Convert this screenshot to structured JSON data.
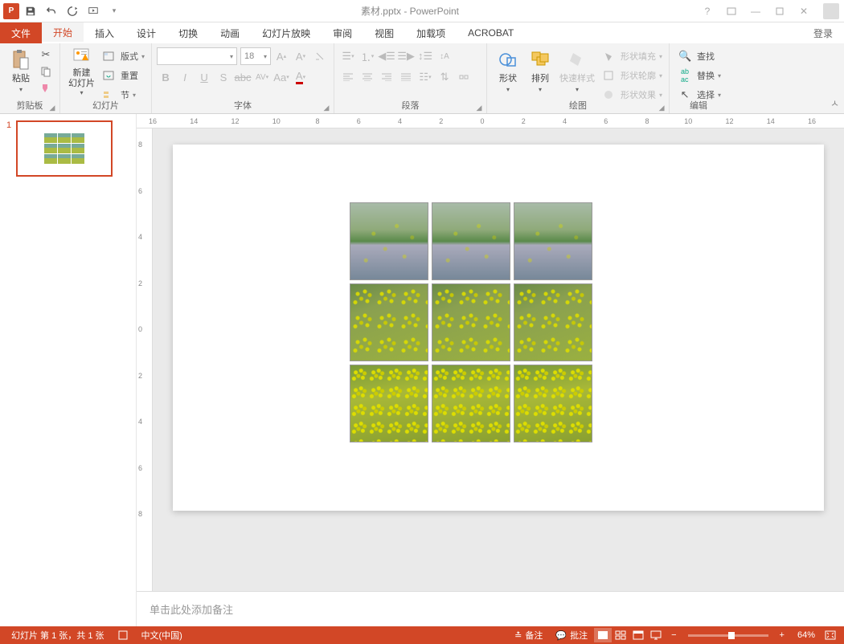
{
  "title": "素材.pptx - PowerPoint",
  "qat": {
    "save": "保存",
    "undo": "撤销",
    "redo": "恢复",
    "start": "从头开始"
  },
  "tabs": {
    "file": "文件",
    "home": "开始",
    "insert": "插入",
    "design": "设计",
    "transition": "切换",
    "animation": "动画",
    "slideshow": "幻灯片放映",
    "review": "审阅",
    "view": "视图",
    "addins": "加载项",
    "acrobat": "ACROBAT",
    "login": "登录"
  },
  "ribbon": {
    "clipboard": {
      "paste": "粘贴",
      "label": "剪贴板"
    },
    "slides": {
      "new": "新建\n幻灯片",
      "layout": "版式",
      "reset": "重置",
      "section": "节",
      "label": "幻灯片"
    },
    "font": {
      "name": "",
      "size": "18",
      "label": "字体"
    },
    "paragraph": {
      "label": "段落"
    },
    "drawing": {
      "shapes": "形状",
      "arrange": "排列",
      "quickstyles": "快速样式",
      "fill": "形状填充",
      "outline": "形状轮廓",
      "effects": "形状效果",
      "label": "绘图"
    },
    "editing": {
      "find": "查找",
      "replace": "替换",
      "select": "选择",
      "label": "编辑"
    }
  },
  "ruler_h": [
    "16",
    "14",
    "12",
    "10",
    "8",
    "6",
    "4",
    "2",
    "0",
    "2",
    "4",
    "6",
    "8",
    "10",
    "12",
    "14",
    "16"
  ],
  "ruler_v": [
    "8",
    "6",
    "4",
    "2",
    "0",
    "2",
    "4",
    "6",
    "8"
  ],
  "slide_number": "1",
  "notes_placeholder": "单击此处添加备注",
  "status": {
    "slide_info": "幻灯片 第 1 张，共 1 张",
    "language": "中文(中国)",
    "notes": "备注",
    "comments": "批注",
    "zoom": "64%"
  }
}
